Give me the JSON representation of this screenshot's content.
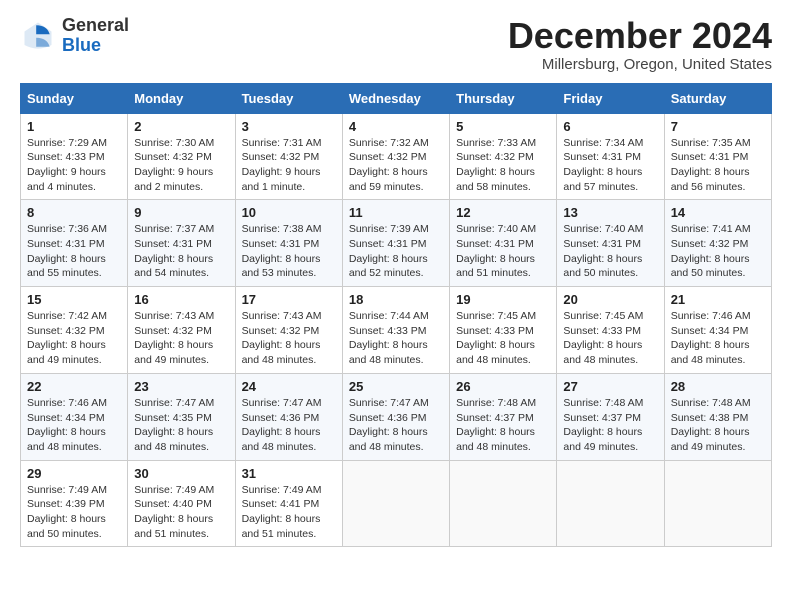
{
  "logo": {
    "general": "General",
    "blue": "Blue"
  },
  "title": "December 2024",
  "subtitle": "Millersburg, Oregon, United States",
  "weekdays": [
    "Sunday",
    "Monday",
    "Tuesday",
    "Wednesday",
    "Thursday",
    "Friday",
    "Saturday"
  ],
  "weeks": [
    [
      {
        "day": "1",
        "sunrise": "Sunrise: 7:29 AM",
        "sunset": "Sunset: 4:33 PM",
        "daylight": "Daylight: 9 hours and 4 minutes."
      },
      {
        "day": "2",
        "sunrise": "Sunrise: 7:30 AM",
        "sunset": "Sunset: 4:32 PM",
        "daylight": "Daylight: 9 hours and 2 minutes."
      },
      {
        "day": "3",
        "sunrise": "Sunrise: 7:31 AM",
        "sunset": "Sunset: 4:32 PM",
        "daylight": "Daylight: 9 hours and 1 minute."
      },
      {
        "day": "4",
        "sunrise": "Sunrise: 7:32 AM",
        "sunset": "Sunset: 4:32 PM",
        "daylight": "Daylight: 8 hours and 59 minutes."
      },
      {
        "day": "5",
        "sunrise": "Sunrise: 7:33 AM",
        "sunset": "Sunset: 4:32 PM",
        "daylight": "Daylight: 8 hours and 58 minutes."
      },
      {
        "day": "6",
        "sunrise": "Sunrise: 7:34 AM",
        "sunset": "Sunset: 4:31 PM",
        "daylight": "Daylight: 8 hours and 57 minutes."
      },
      {
        "day": "7",
        "sunrise": "Sunrise: 7:35 AM",
        "sunset": "Sunset: 4:31 PM",
        "daylight": "Daylight: 8 hours and 56 minutes."
      }
    ],
    [
      {
        "day": "8",
        "sunrise": "Sunrise: 7:36 AM",
        "sunset": "Sunset: 4:31 PM",
        "daylight": "Daylight: 8 hours and 55 minutes."
      },
      {
        "day": "9",
        "sunrise": "Sunrise: 7:37 AM",
        "sunset": "Sunset: 4:31 PM",
        "daylight": "Daylight: 8 hours and 54 minutes."
      },
      {
        "day": "10",
        "sunrise": "Sunrise: 7:38 AM",
        "sunset": "Sunset: 4:31 PM",
        "daylight": "Daylight: 8 hours and 53 minutes."
      },
      {
        "day": "11",
        "sunrise": "Sunrise: 7:39 AM",
        "sunset": "Sunset: 4:31 PM",
        "daylight": "Daylight: 8 hours and 52 minutes."
      },
      {
        "day": "12",
        "sunrise": "Sunrise: 7:40 AM",
        "sunset": "Sunset: 4:31 PM",
        "daylight": "Daylight: 8 hours and 51 minutes."
      },
      {
        "day": "13",
        "sunrise": "Sunrise: 7:40 AM",
        "sunset": "Sunset: 4:31 PM",
        "daylight": "Daylight: 8 hours and 50 minutes."
      },
      {
        "day": "14",
        "sunrise": "Sunrise: 7:41 AM",
        "sunset": "Sunset: 4:32 PM",
        "daylight": "Daylight: 8 hours and 50 minutes."
      }
    ],
    [
      {
        "day": "15",
        "sunrise": "Sunrise: 7:42 AM",
        "sunset": "Sunset: 4:32 PM",
        "daylight": "Daylight: 8 hours and 49 minutes."
      },
      {
        "day": "16",
        "sunrise": "Sunrise: 7:43 AM",
        "sunset": "Sunset: 4:32 PM",
        "daylight": "Daylight: 8 hours and 49 minutes."
      },
      {
        "day": "17",
        "sunrise": "Sunrise: 7:43 AM",
        "sunset": "Sunset: 4:32 PM",
        "daylight": "Daylight: 8 hours and 48 minutes."
      },
      {
        "day": "18",
        "sunrise": "Sunrise: 7:44 AM",
        "sunset": "Sunset: 4:33 PM",
        "daylight": "Daylight: 8 hours and 48 minutes."
      },
      {
        "day": "19",
        "sunrise": "Sunrise: 7:45 AM",
        "sunset": "Sunset: 4:33 PM",
        "daylight": "Daylight: 8 hours and 48 minutes."
      },
      {
        "day": "20",
        "sunrise": "Sunrise: 7:45 AM",
        "sunset": "Sunset: 4:33 PM",
        "daylight": "Daylight: 8 hours and 48 minutes."
      },
      {
        "day": "21",
        "sunrise": "Sunrise: 7:46 AM",
        "sunset": "Sunset: 4:34 PM",
        "daylight": "Daylight: 8 hours and 48 minutes."
      }
    ],
    [
      {
        "day": "22",
        "sunrise": "Sunrise: 7:46 AM",
        "sunset": "Sunset: 4:34 PM",
        "daylight": "Daylight: 8 hours and 48 minutes."
      },
      {
        "day": "23",
        "sunrise": "Sunrise: 7:47 AM",
        "sunset": "Sunset: 4:35 PM",
        "daylight": "Daylight: 8 hours and 48 minutes."
      },
      {
        "day": "24",
        "sunrise": "Sunrise: 7:47 AM",
        "sunset": "Sunset: 4:36 PM",
        "daylight": "Daylight: 8 hours and 48 minutes."
      },
      {
        "day": "25",
        "sunrise": "Sunrise: 7:47 AM",
        "sunset": "Sunset: 4:36 PM",
        "daylight": "Daylight: 8 hours and 48 minutes."
      },
      {
        "day": "26",
        "sunrise": "Sunrise: 7:48 AM",
        "sunset": "Sunset: 4:37 PM",
        "daylight": "Daylight: 8 hours and 48 minutes."
      },
      {
        "day": "27",
        "sunrise": "Sunrise: 7:48 AM",
        "sunset": "Sunset: 4:37 PM",
        "daylight": "Daylight: 8 hours and 49 minutes."
      },
      {
        "day": "28",
        "sunrise": "Sunrise: 7:48 AM",
        "sunset": "Sunset: 4:38 PM",
        "daylight": "Daylight: 8 hours and 49 minutes."
      }
    ],
    [
      {
        "day": "29",
        "sunrise": "Sunrise: 7:49 AM",
        "sunset": "Sunset: 4:39 PM",
        "daylight": "Daylight: 8 hours and 50 minutes."
      },
      {
        "day": "30",
        "sunrise": "Sunrise: 7:49 AM",
        "sunset": "Sunset: 4:40 PM",
        "daylight": "Daylight: 8 hours and 51 minutes."
      },
      {
        "day": "31",
        "sunrise": "Sunrise: 7:49 AM",
        "sunset": "Sunset: 4:41 PM",
        "daylight": "Daylight: 8 hours and 51 minutes."
      },
      null,
      null,
      null,
      null
    ]
  ]
}
